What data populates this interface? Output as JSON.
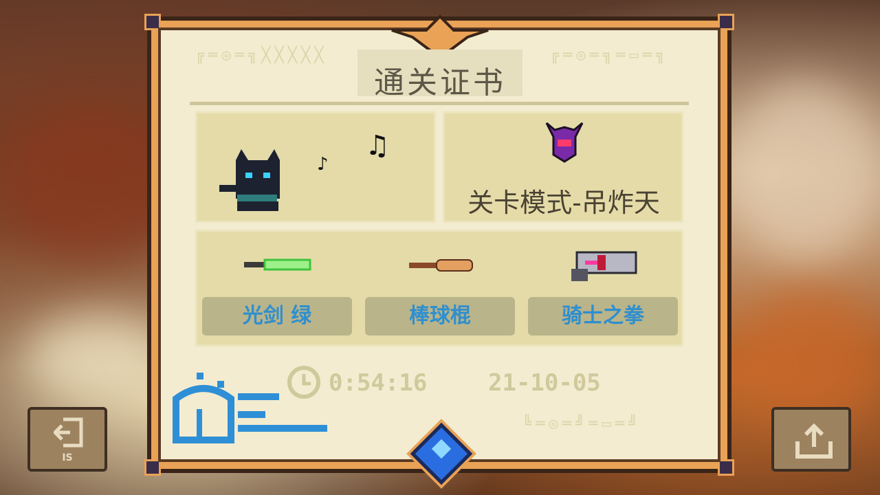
{
  "certificate": {
    "title": "通关证书"
  },
  "character": {
    "icon": "black-cat-icon",
    "notes_icon": "music-notes-icon"
  },
  "mode": {
    "boss_icon": "purple-horned-helmet-icon",
    "label": "关卡模式-吊炸天"
  },
  "weapons": [
    {
      "icon": "green-lightsaber-icon",
      "label": "光剑 绿"
    },
    {
      "icon": "baseball-bat-icon",
      "label": "棒球棍"
    },
    {
      "icon": "knight-fist-gun-icon",
      "label": "骑士之拳"
    }
  ],
  "stats": {
    "clock_icon": "clock-icon",
    "time": "0:54:16",
    "date": "21-10-05"
  },
  "buttons": {
    "exit_label": "IS",
    "exit_icon": "exit-door-icon",
    "share_icon": "share-upload-icon"
  },
  "colors": {
    "frame": "#e9a256",
    "paper": "#f3ecd0",
    "weapon_text": "#2f8fcf"
  }
}
